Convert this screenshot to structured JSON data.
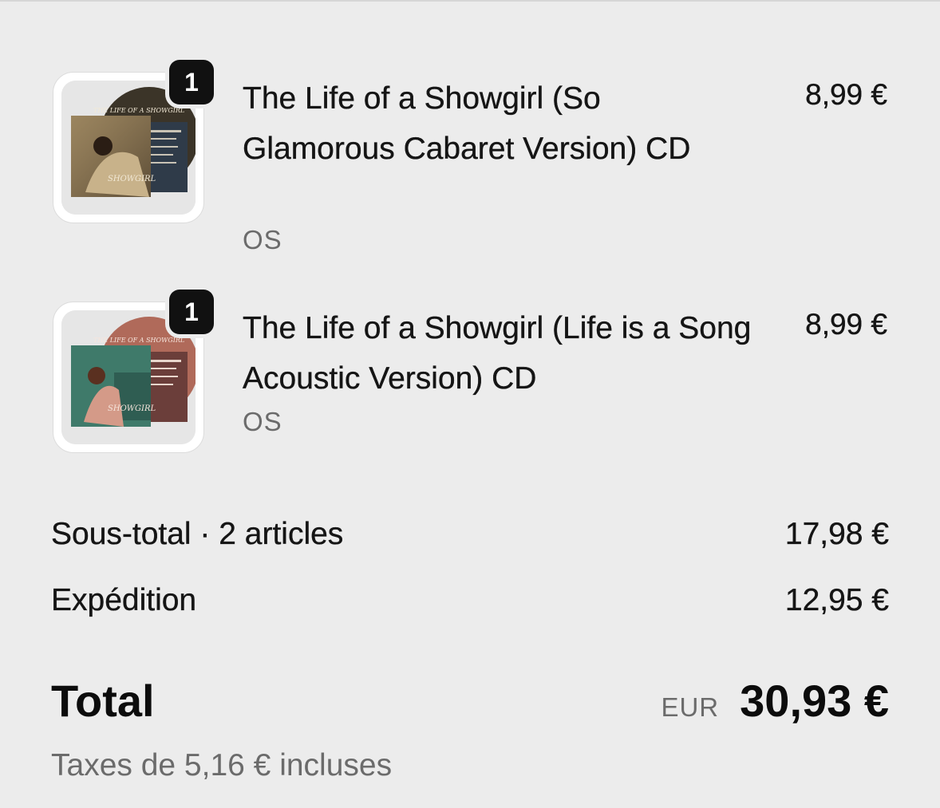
{
  "items": [
    {
      "quantity": "1",
      "title": "The Life of a Showgirl (So Glamorous Cabaret Version) CD",
      "vendor": "OS",
      "price": "8,99 €",
      "thumbnail": {
        "icon": "cd-album-cover-image",
        "accent": "#b59a6b",
        "text": "THE LIFE OF A SHOWGIRL"
      }
    },
    {
      "quantity": "1",
      "title": "The Life of a Showgirl (Life is a Song Acoustic Version) CD",
      "vendor": "OS",
      "price": "8,99 €",
      "thumbnail": {
        "icon": "cd-album-cover-image",
        "accent": "#3f7a6a",
        "text": "THE LIFE OF A SHOWGIRL"
      }
    }
  ],
  "summary": {
    "subtotal_label": "Sous-total · 2 articles",
    "subtotal_value": "17,98 €",
    "shipping_label": "Expédition",
    "shipping_value": "12,95 €",
    "total_label": "Total",
    "total_currency": "EUR",
    "total_value": "30,93 €",
    "taxes_note": "Taxes de 5,16 € incluses"
  }
}
